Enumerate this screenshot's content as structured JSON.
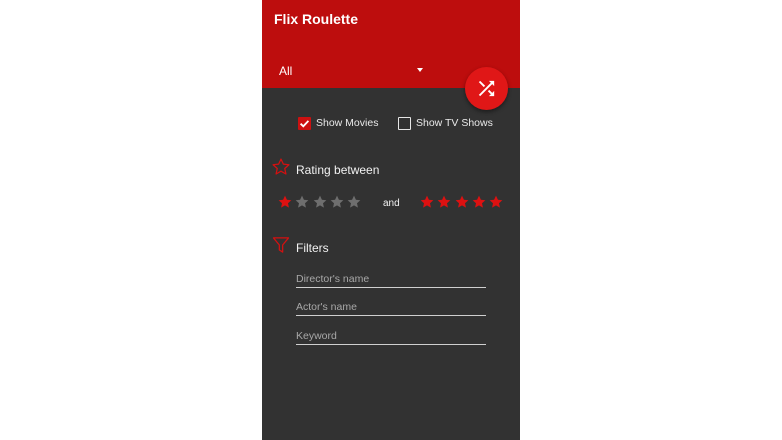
{
  "app": {
    "title": "Flix Roulette"
  },
  "filter_type": {
    "selected": "All"
  },
  "fab": {
    "icon": "shuffle-icon"
  },
  "toggles": {
    "movies": {
      "label": "Show Movies",
      "checked": true
    },
    "tv": {
      "label": "Show TV Shows",
      "checked": false
    }
  },
  "rating": {
    "title": "Rating between",
    "icon": "star-outline-icon",
    "connector": "and",
    "min_stars": 1,
    "max_stars": 5,
    "total_stars": 5
  },
  "filters": {
    "title": "Filters",
    "icon": "funnel-icon",
    "director_placeholder": "Director's name",
    "actor_placeholder": "Actor's name",
    "keyword_placeholder": "Keyword"
  },
  "colors": {
    "accent": "#bd0d0d",
    "fab": "#e01717",
    "star_active": "#dd1111",
    "star_inactive": "#6e6e6e",
    "background": "#323232"
  }
}
